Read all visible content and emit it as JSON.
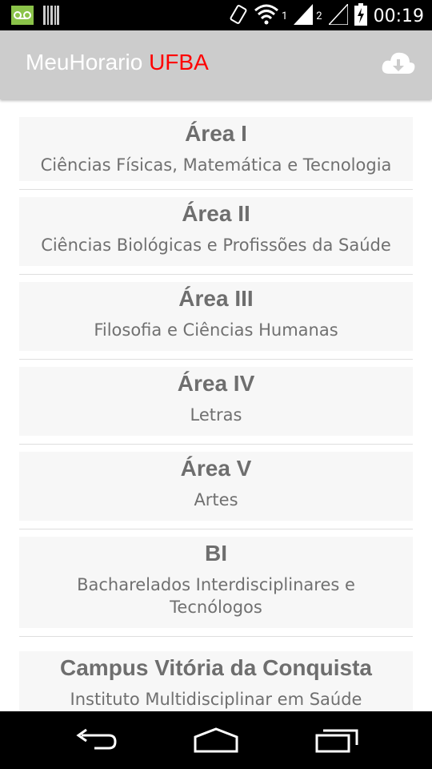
{
  "status_bar": {
    "time": "00:19",
    "sim1": "1",
    "sim2": "2",
    "icons": [
      "voicemail-icon",
      "barcode-icon",
      "vibrate-icon",
      "wifi-icon",
      "signal-icon",
      "battery-icon"
    ]
  },
  "action_bar": {
    "title_main": "MeuHorario ",
    "title_accent": "UFBA",
    "accent_color": "#ff0000",
    "action_icon": "cloud-download-icon"
  },
  "areas": [
    {
      "title": "Área I",
      "subtitle": "Ciências Físicas, Matemática e Tecnologia"
    },
    {
      "title": "Área II",
      "subtitle": "Ciências Biológicas e Profissões da Saúde"
    },
    {
      "title": "Área III",
      "subtitle": "Filosofia e Ciências Humanas"
    },
    {
      "title": "Área IV",
      "subtitle": "Letras"
    },
    {
      "title": "Área V",
      "subtitle": "Artes"
    },
    {
      "title": "BI",
      "subtitle": "Bacharelados Interdisciplinares e Tecnólogos"
    },
    {
      "title": "Campus Vitória da Conquista",
      "subtitle": "Instituto Multidisciplinar em Saúde"
    }
  ],
  "nav_bar": {
    "icons": [
      "back-icon",
      "home-icon",
      "recent-apps-icon"
    ]
  }
}
